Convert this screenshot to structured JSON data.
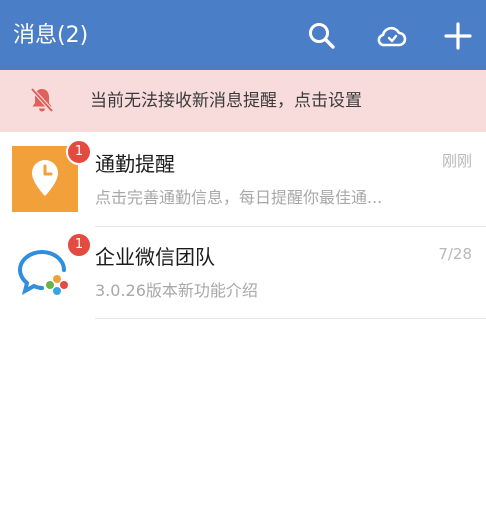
{
  "header": {
    "title": "消息(2)",
    "icons": [
      "search-icon",
      "cloud-sync-icon",
      "add-icon"
    ]
  },
  "notice": {
    "icon": "bell-muted-icon",
    "text": "当前无法接收新消息提醒，点击设置"
  },
  "conversations": [
    {
      "name": "通勤提醒",
      "preview": "点击完善通勤信息，每日提醒你最佳通...",
      "time": "刚刚",
      "badge": "1",
      "avatar_icon": "clock-location-icon",
      "avatar_color": "#f2a03a"
    },
    {
      "name": "企业微信团队",
      "preview": "3.0.26版本新功能介绍",
      "time": "7/28",
      "badge": "1",
      "avatar_icon": "wecom-logo-icon"
    }
  ],
  "colors": {
    "header_bg": "#4a7ec6",
    "notice_bg": "#f8dcdc",
    "badge": "#e34b40"
  }
}
